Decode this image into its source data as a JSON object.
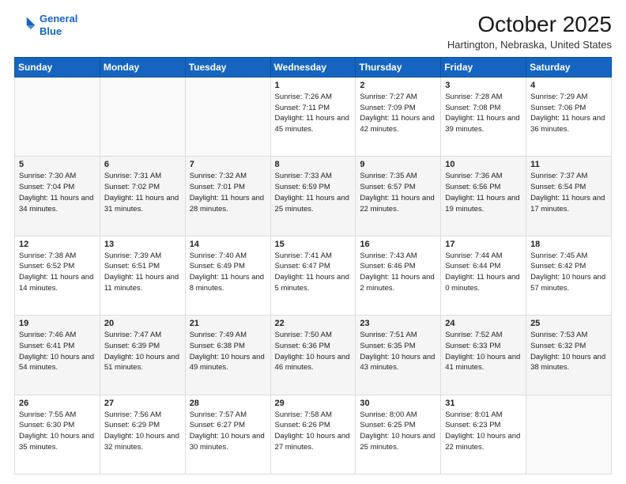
{
  "header": {
    "logo_line1": "General",
    "logo_line2": "Blue",
    "title": "October 2025",
    "subtitle": "Hartington, Nebraska, United States"
  },
  "days_of_week": [
    "Sunday",
    "Monday",
    "Tuesday",
    "Wednesday",
    "Thursday",
    "Friday",
    "Saturday"
  ],
  "weeks": [
    [
      {
        "num": "",
        "sunrise": "",
        "sunset": "",
        "daylight": ""
      },
      {
        "num": "",
        "sunrise": "",
        "sunset": "",
        "daylight": ""
      },
      {
        "num": "",
        "sunrise": "",
        "sunset": "",
        "daylight": ""
      },
      {
        "num": "1",
        "sunrise": "Sunrise: 7:26 AM",
        "sunset": "Sunset: 7:11 PM",
        "daylight": "Daylight: 11 hours and 45 minutes."
      },
      {
        "num": "2",
        "sunrise": "Sunrise: 7:27 AM",
        "sunset": "Sunset: 7:09 PM",
        "daylight": "Daylight: 11 hours and 42 minutes."
      },
      {
        "num": "3",
        "sunrise": "Sunrise: 7:28 AM",
        "sunset": "Sunset: 7:08 PM",
        "daylight": "Daylight: 11 hours and 39 minutes."
      },
      {
        "num": "4",
        "sunrise": "Sunrise: 7:29 AM",
        "sunset": "Sunset: 7:06 PM",
        "daylight": "Daylight: 11 hours and 36 minutes."
      }
    ],
    [
      {
        "num": "5",
        "sunrise": "Sunrise: 7:30 AM",
        "sunset": "Sunset: 7:04 PM",
        "daylight": "Daylight: 11 hours and 34 minutes."
      },
      {
        "num": "6",
        "sunrise": "Sunrise: 7:31 AM",
        "sunset": "Sunset: 7:02 PM",
        "daylight": "Daylight: 11 hours and 31 minutes."
      },
      {
        "num": "7",
        "sunrise": "Sunrise: 7:32 AM",
        "sunset": "Sunset: 7:01 PM",
        "daylight": "Daylight: 11 hours and 28 minutes."
      },
      {
        "num": "8",
        "sunrise": "Sunrise: 7:33 AM",
        "sunset": "Sunset: 6:59 PM",
        "daylight": "Daylight: 11 hours and 25 minutes."
      },
      {
        "num": "9",
        "sunrise": "Sunrise: 7:35 AM",
        "sunset": "Sunset: 6:57 PM",
        "daylight": "Daylight: 11 hours and 22 minutes."
      },
      {
        "num": "10",
        "sunrise": "Sunrise: 7:36 AM",
        "sunset": "Sunset: 6:56 PM",
        "daylight": "Daylight: 11 hours and 19 minutes."
      },
      {
        "num": "11",
        "sunrise": "Sunrise: 7:37 AM",
        "sunset": "Sunset: 6:54 PM",
        "daylight": "Daylight: 11 hours and 17 minutes."
      }
    ],
    [
      {
        "num": "12",
        "sunrise": "Sunrise: 7:38 AM",
        "sunset": "Sunset: 6:52 PM",
        "daylight": "Daylight: 11 hours and 14 minutes."
      },
      {
        "num": "13",
        "sunrise": "Sunrise: 7:39 AM",
        "sunset": "Sunset: 6:51 PM",
        "daylight": "Daylight: 11 hours and 11 minutes."
      },
      {
        "num": "14",
        "sunrise": "Sunrise: 7:40 AM",
        "sunset": "Sunset: 6:49 PM",
        "daylight": "Daylight: 11 hours and 8 minutes."
      },
      {
        "num": "15",
        "sunrise": "Sunrise: 7:41 AM",
        "sunset": "Sunset: 6:47 PM",
        "daylight": "Daylight: 11 hours and 5 minutes."
      },
      {
        "num": "16",
        "sunrise": "Sunrise: 7:43 AM",
        "sunset": "Sunset: 6:46 PM",
        "daylight": "Daylight: 11 hours and 2 minutes."
      },
      {
        "num": "17",
        "sunrise": "Sunrise: 7:44 AM",
        "sunset": "Sunset: 6:44 PM",
        "daylight": "Daylight: 11 hours and 0 minutes."
      },
      {
        "num": "18",
        "sunrise": "Sunrise: 7:45 AM",
        "sunset": "Sunset: 6:42 PM",
        "daylight": "Daylight: 10 hours and 57 minutes."
      }
    ],
    [
      {
        "num": "19",
        "sunrise": "Sunrise: 7:46 AM",
        "sunset": "Sunset: 6:41 PM",
        "daylight": "Daylight: 10 hours and 54 minutes."
      },
      {
        "num": "20",
        "sunrise": "Sunrise: 7:47 AM",
        "sunset": "Sunset: 6:39 PM",
        "daylight": "Daylight: 10 hours and 51 minutes."
      },
      {
        "num": "21",
        "sunrise": "Sunrise: 7:49 AM",
        "sunset": "Sunset: 6:38 PM",
        "daylight": "Daylight: 10 hours and 49 minutes."
      },
      {
        "num": "22",
        "sunrise": "Sunrise: 7:50 AM",
        "sunset": "Sunset: 6:36 PM",
        "daylight": "Daylight: 10 hours and 46 minutes."
      },
      {
        "num": "23",
        "sunrise": "Sunrise: 7:51 AM",
        "sunset": "Sunset: 6:35 PM",
        "daylight": "Daylight: 10 hours and 43 minutes."
      },
      {
        "num": "24",
        "sunrise": "Sunrise: 7:52 AM",
        "sunset": "Sunset: 6:33 PM",
        "daylight": "Daylight: 10 hours and 41 minutes."
      },
      {
        "num": "25",
        "sunrise": "Sunrise: 7:53 AM",
        "sunset": "Sunset: 6:32 PM",
        "daylight": "Daylight: 10 hours and 38 minutes."
      }
    ],
    [
      {
        "num": "26",
        "sunrise": "Sunrise: 7:55 AM",
        "sunset": "Sunset: 6:30 PM",
        "daylight": "Daylight: 10 hours and 35 minutes."
      },
      {
        "num": "27",
        "sunrise": "Sunrise: 7:56 AM",
        "sunset": "Sunset: 6:29 PM",
        "daylight": "Daylight: 10 hours and 32 minutes."
      },
      {
        "num": "28",
        "sunrise": "Sunrise: 7:57 AM",
        "sunset": "Sunset: 6:27 PM",
        "daylight": "Daylight: 10 hours and 30 minutes."
      },
      {
        "num": "29",
        "sunrise": "Sunrise: 7:58 AM",
        "sunset": "Sunset: 6:26 PM",
        "daylight": "Daylight: 10 hours and 27 minutes."
      },
      {
        "num": "30",
        "sunrise": "Sunrise: 8:00 AM",
        "sunset": "Sunset: 6:25 PM",
        "daylight": "Daylight: 10 hours and 25 minutes."
      },
      {
        "num": "31",
        "sunrise": "Sunrise: 8:01 AM",
        "sunset": "Sunset: 6:23 PM",
        "daylight": "Daylight: 10 hours and 22 minutes."
      },
      {
        "num": "",
        "sunrise": "",
        "sunset": "",
        "daylight": ""
      }
    ]
  ]
}
